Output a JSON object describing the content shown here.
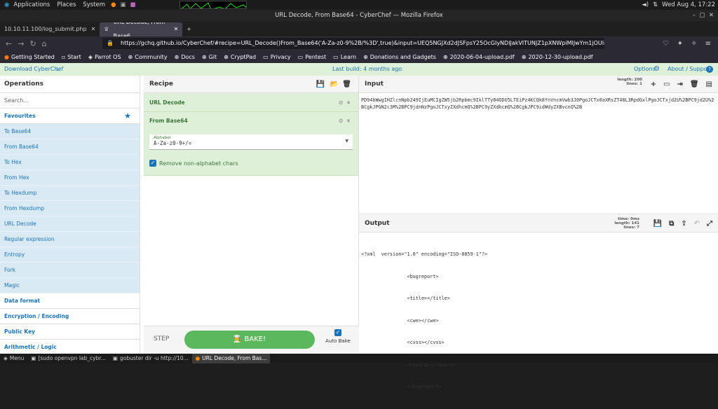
{
  "system": {
    "applications": "Applications",
    "places": "Places",
    "system": "System",
    "clock": "Wed Aug 4, 17:22"
  },
  "window": {
    "title": "URL Decode, From Base64 - CyberChef — Mozilla Firefox"
  },
  "tabs": [
    {
      "label": "10.10.11.100/log_submit.php"
    },
    {
      "label": "URL Decode, From Base6"
    }
  ],
  "url": "https://gchq.github.io/CyberChef/#recipe=URL_Decode()From_Base64('A-Za-z0-9%2B/%3D',true)&input=UEQ5NGJXd2dJSFpsY25OcGIyNDlJakVITUNJZ1pXNWpiMlJwYm1jOUlrbFRU",
  "bookmarks": [
    "Getting Started",
    "Start",
    "Parrot OS",
    "Community",
    "Docs",
    "Git",
    "CryptPad",
    "Privacy",
    "Pentest",
    "Learn",
    "Donations and Gadgets",
    "2020-06-04-upload.pdf",
    "2020-12-30-upload.pdf"
  ],
  "banner": {
    "download": "Download CyberChef",
    "last_build": "Last build: 4 months ago",
    "options": "Options",
    "about": "About / Support"
  },
  "operations": {
    "title": "Operations",
    "search_placeholder": "Search...",
    "favourites": "Favourites",
    "items": [
      "To Base64",
      "From Base64",
      "To Hex",
      "From Hex",
      "To Hexdump",
      "From Hexdump",
      "URL Decode",
      "Regular expression",
      "Entropy",
      "Fork",
      "Magic"
    ],
    "categories": [
      "Data format",
      "Encryption / Encoding",
      "Public Key",
      "Arithmetic / Logic"
    ]
  },
  "recipe": {
    "title": "Recipe",
    "op1": "URL Decode",
    "op2": "From Base64",
    "alphabet_label": "Alphabet",
    "alphabet_value": "A-Za-z0-9+/=",
    "remove_label": "Remove non-alphabet chars",
    "step": "STEP",
    "bake": "BAKE!",
    "autobake": "Auto Bake"
  },
  "input": {
    "title": "Input",
    "length_label": "length:",
    "length": "200",
    "lines_label": "lines:",
    "lines": "1",
    "text": "PD94bWwgIHZlcnNpb249IjEuMCIgZW5jb2Rpbmc9IklTTy04ODU5LTEiPz4KCQk8YnVncmVwb3J0PgoJCTx0aXRsZT48L3RpdGxlPgoJCTxjd2U%2BPC9jd2U%2BCgkJPGN2c3M%2BPC9jdnNzPgoJCTxyZXdhcmQ%2BPC9yZXdhcmQ%2BCgkJPC9idWdyZXBvcnQ%2B"
  },
  "output": {
    "title": "Output",
    "time_label": "time:",
    "time": "0ms",
    "length_label": "length:",
    "length": "141",
    "lines_label": "lines:",
    "lines": "7",
    "lines_text": [
      "<?xml  version=\"1.0\" encoding=\"ISO-8859-1\"?>",
      "\t\t<bugreport>",
      "\t\t<title></title>",
      "\t\t<cwe></cwe>",
      "\t\t<cvss></cvss>",
      "\t\t<reward></reward>",
      "\t\t</bugreport>"
    ]
  },
  "taskbar": {
    "menu": "Menu",
    "items": [
      "[sudo openvpn lab_cybr...",
      "gobuster dir -u http://10...",
      "URL Decode, From Bas..."
    ]
  },
  "colors": {
    "accent": "#1a73b7",
    "bake": "#5cb85c",
    "recipe_bg": "#dff0d8"
  }
}
